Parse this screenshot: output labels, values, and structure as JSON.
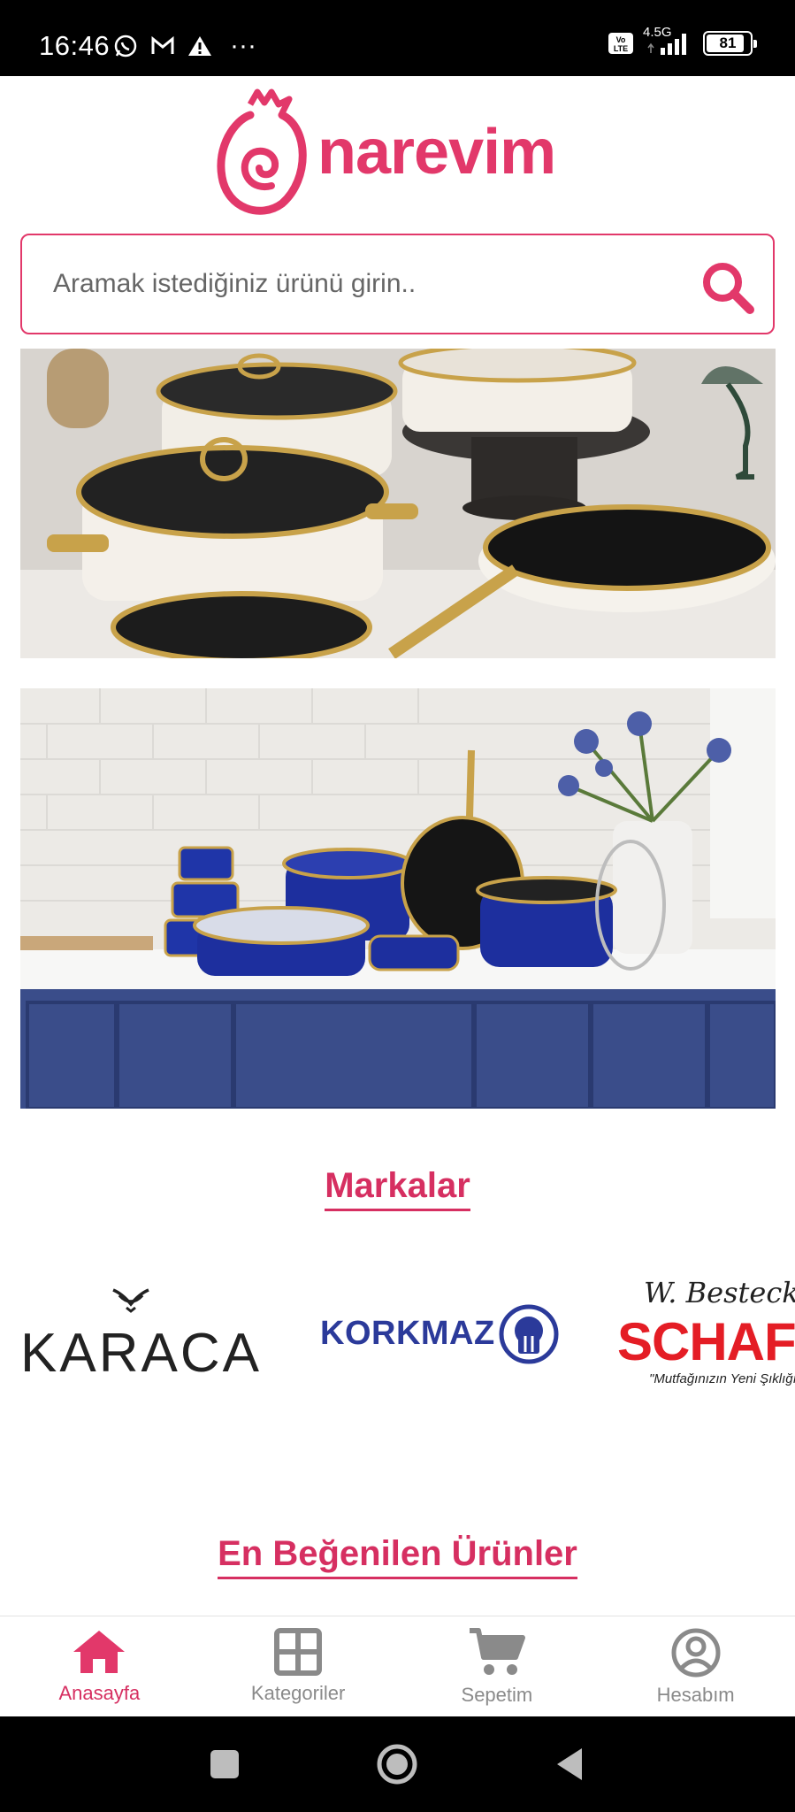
{
  "status_bar": {
    "time": "16:46",
    "network": "4.5G",
    "battery": "81"
  },
  "header": {
    "logo_text": "narevim"
  },
  "search": {
    "placeholder": "Aramak istediğiniz ürünü girin.."
  },
  "sections": {
    "brands_title": "Markalar",
    "popular_title": "En Beğenilen Ürünler"
  },
  "brands": [
    {
      "name": "KARACA"
    },
    {
      "name": "KORKMAZ"
    },
    {
      "name": "SCHAFER",
      "tagline_top": "W. Bestecklhaus",
      "tagline_bottom": "\"Mutfağınızın Yeni Şıklığı\""
    }
  ],
  "bottom_nav": {
    "items": [
      {
        "label": "Anasayfa",
        "icon": "home-icon",
        "active": true
      },
      {
        "label": "Kategoriler",
        "icon": "grid-icon",
        "active": false
      },
      {
        "label": "Sepetim",
        "icon": "cart-icon",
        "active": false
      },
      {
        "label": "Hesabım",
        "icon": "account-icon",
        "active": false
      }
    ]
  },
  "colors": {
    "brand": "#e2386a",
    "nav_inactive": "#8a8a8a"
  }
}
